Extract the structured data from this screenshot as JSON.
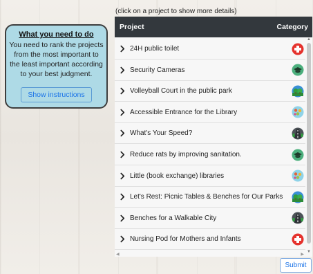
{
  "instructions": {
    "title": "What you need to do",
    "text": "You need to rank the projects from the most important to the least important according to your best judgment.",
    "show_button": "Show instructions"
  },
  "hint": "(click on a project to show more details)",
  "table": {
    "col_project": "Project",
    "col_category": "Category"
  },
  "projects": [
    {
      "label": "24H public toilet",
      "icon": "health-icon"
    },
    {
      "label": "Security Cameras",
      "icon": "education-icon"
    },
    {
      "label": "Volleyball Court in the public park",
      "icon": "parks-icon"
    },
    {
      "label": "Accessible Entrance for the Library",
      "icon": "community-icon"
    },
    {
      "label": "What's Your Speed?",
      "icon": "road-icon"
    },
    {
      "label": "Reduce rats by improving sanitation.",
      "icon": "education-icon"
    },
    {
      "label": "Little (book exchange) libraries",
      "icon": "community-icon"
    },
    {
      "label": "Let's Rest: Picnic Tables & Benches for Our Parks",
      "icon": "parks-icon"
    },
    {
      "label": "Benches for a Walkable City",
      "icon": "road-icon"
    },
    {
      "label": "Nursing Pod for Mothers and Infants",
      "icon": "health-icon"
    }
  ],
  "submit_label": "Submit"
}
